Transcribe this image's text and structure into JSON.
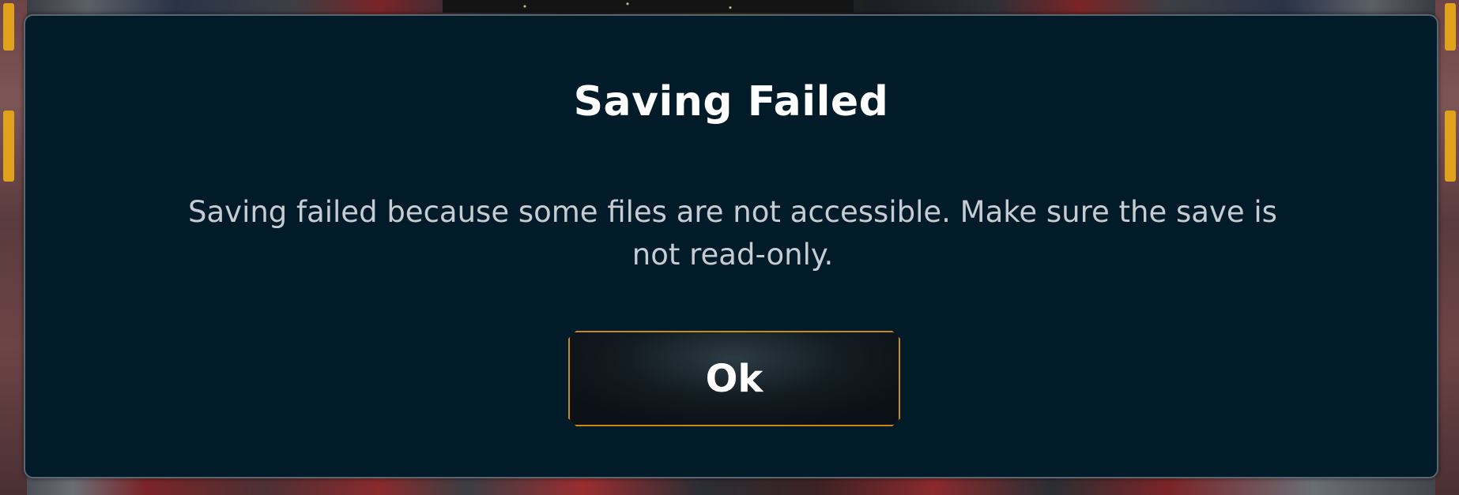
{
  "dialog": {
    "title": "Saving Failed",
    "message": "Saving failed because some files are not accessible. Make sure the save is not read-only.",
    "ok_label": "Ok"
  },
  "colors": {
    "dialog_background": "#021b29",
    "dialog_border": "#5c6670",
    "button_border": "#c98a1c",
    "title_text": "#ffffff",
    "message_text": "#c6ccd2"
  }
}
